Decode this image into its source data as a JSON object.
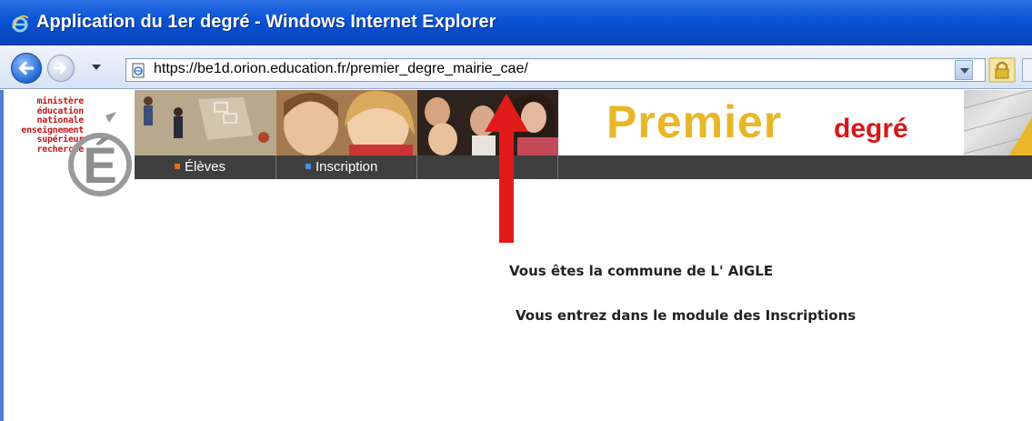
{
  "window": {
    "title": "Application du 1er degré - Windows Internet Explorer",
    "browser_icon": "ie-icon"
  },
  "address_bar": {
    "url": "https://be1d.orion.education.fr/premier_degre_mairie_cae/",
    "icons": [
      "back-arrow-icon",
      "forward-arrow-icon",
      "page-icon",
      "lock-icon"
    ]
  },
  "ministry_logo": {
    "lines": [
      "ministère",
      "éducation",
      "nationale",
      "enseignement",
      "supérieur",
      "recherche"
    ],
    "glyph": "É",
    "color": "#c21818"
  },
  "banner": {
    "title_main": "Premier",
    "title_sub": "degré",
    "title_main_color": "#e8b628",
    "title_sub_color": "#d51818"
  },
  "menu": {
    "items": [
      {
        "label": "Élèves",
        "bullet_color": "#e07020"
      },
      {
        "label": "Inscription",
        "bullet_color": "#4a8fe0"
      }
    ]
  },
  "content": {
    "commune_message": "Vous êtes la commune de L' AIGLE",
    "module_message": "Vous entrez dans le module des Inscriptions"
  },
  "annotation": {
    "arrow_color": "#e31a1a"
  }
}
